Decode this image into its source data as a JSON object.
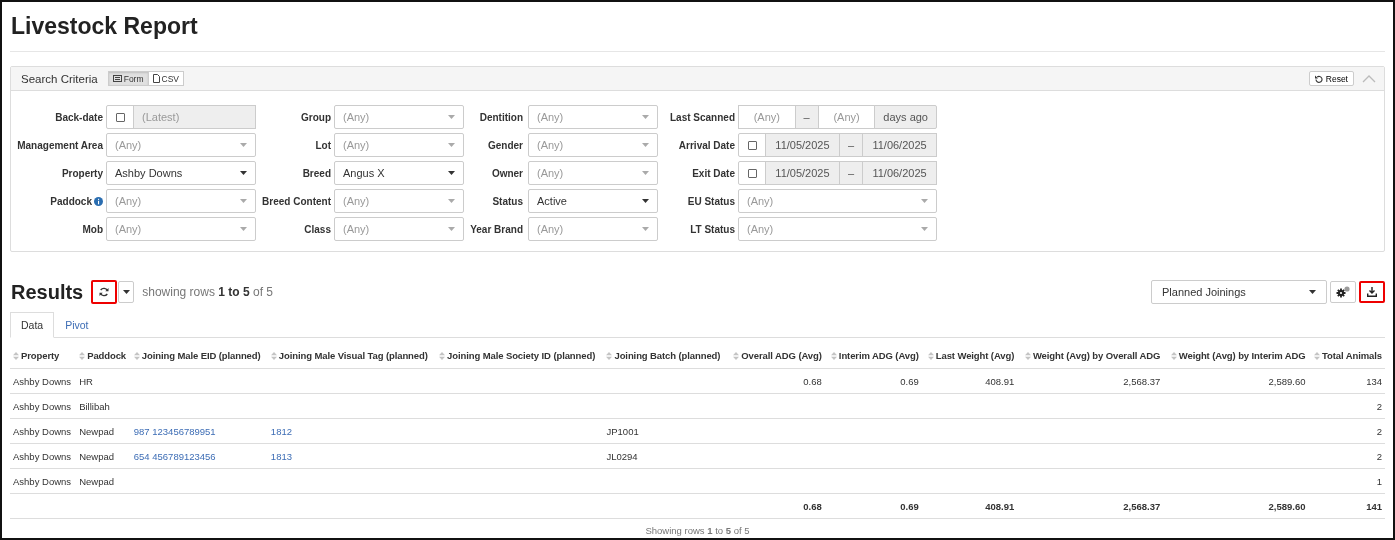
{
  "page_title": "Livestock Report",
  "search": {
    "title": "Search Criteria",
    "modes": [
      {
        "label": "Form",
        "kind": "form",
        "selected": true
      },
      {
        "label": "CSV",
        "kind": "csv",
        "selected": false
      }
    ],
    "reset": "Reset",
    "columns": [
      [
        {
          "label": "Back-date",
          "kind": "checkdate",
          "checked": false,
          "placeholder": "(Latest)"
        },
        {
          "label": "Management Area",
          "kind": "select",
          "placeholder": "(Any)"
        },
        {
          "label": "Property",
          "kind": "select",
          "value": "Ashby Downs"
        },
        {
          "label": "Paddock",
          "kind": "select",
          "placeholder": "(Any)",
          "info": true
        },
        {
          "label": "Mob",
          "kind": "select",
          "placeholder": "(Any)"
        }
      ],
      [
        {
          "label": "Group",
          "kind": "select",
          "placeholder": "(Any)"
        },
        {
          "label": "Lot",
          "kind": "select",
          "placeholder": "(Any)"
        },
        {
          "label": "Breed",
          "kind": "select",
          "value": "Angus X"
        },
        {
          "label": "Breed Content",
          "kind": "select",
          "placeholder": "(Any)"
        },
        {
          "label": "Class",
          "kind": "select",
          "placeholder": "(Any)"
        }
      ],
      [
        {
          "label": "Dentition",
          "kind": "select",
          "placeholder": "(Any)"
        },
        {
          "label": "Gender",
          "kind": "select",
          "placeholder": "(Any)"
        },
        {
          "label": "Owner",
          "kind": "select",
          "placeholder": "(Any)"
        },
        {
          "label": "Status",
          "kind": "select",
          "value": "Active"
        },
        {
          "label": "Year Brand",
          "kind": "select",
          "placeholder": "(Any)"
        }
      ],
      [
        {
          "label": "Last Scanned",
          "kind": "range",
          "from_placeholder": "(Any)",
          "separator": "–",
          "to_placeholder": "(Any)",
          "suffix": "days ago"
        },
        {
          "label": "Arrival Date",
          "kind": "daterange",
          "checked": false,
          "from": "11/05/2025",
          "separator": "–",
          "to": "11/06/2025"
        },
        {
          "label": "Exit Date",
          "kind": "daterange",
          "checked": false,
          "from": "11/05/2025",
          "separator": "–",
          "to": "11/06/2025"
        },
        {
          "label": "EU Status",
          "kind": "select",
          "placeholder": "(Any)"
        },
        {
          "label": "LT Status",
          "kind": "select",
          "placeholder": "(Any)"
        }
      ]
    ]
  },
  "results": {
    "title": "Results",
    "refresh_highlighted": true,
    "summary": "showing rows **1 to 5** of 5",
    "view": "Planned Joinings",
    "download_highlighted": true,
    "tabs": [
      {
        "label": "Data",
        "selected": true
      },
      {
        "label": "Pivot",
        "selected": false
      }
    ],
    "table": {
      "columns": [
        {
          "label": "Property",
          "kind": "text"
        },
        {
          "label": "Paddock",
          "kind": "text"
        },
        {
          "label": "Joining Male EID (planned)",
          "kind": "link"
        },
        {
          "label": "Joining Male Visual Tag (planned)",
          "kind": "link"
        },
        {
          "label": "Joining Male Society ID (planned)",
          "kind": "text"
        },
        {
          "label": "Joining Batch (planned)",
          "kind": "text"
        },
        {
          "label": "Overall ADG (Avg)",
          "kind": "number"
        },
        {
          "label": "Interim ADG (Avg)",
          "kind": "number"
        },
        {
          "label": "Last Weight (Avg)",
          "kind": "number"
        },
        {
          "label": "Weight (Avg) by Overall ADG",
          "kind": "number"
        },
        {
          "label": "Weight (Avg) by Interim ADG",
          "kind": "number"
        },
        {
          "label": "Total Animals",
          "kind": "number"
        }
      ],
      "rows": [
        [
          "Ashby Downs",
          "HR",
          null,
          null,
          null,
          null,
          "0.68",
          "0.69",
          "408.91",
          "2,568.37",
          "2,589.60",
          "134"
        ],
        [
          "Ashby Downs",
          "Billibah",
          null,
          null,
          null,
          null,
          null,
          null,
          null,
          null,
          null,
          "2"
        ],
        [
          "Ashby Downs",
          "Newpad",
          "987 123456789951",
          "1812",
          null,
          "JP1001",
          null,
          null,
          null,
          null,
          null,
          "2"
        ],
        [
          "Ashby Downs",
          "Newpad",
          "654 456789123456",
          "1813",
          null,
          "JL0294",
          null,
          null,
          null,
          null,
          null,
          "2"
        ],
        [
          "Ashby Downs",
          "Newpad",
          null,
          null,
          null,
          null,
          null,
          null,
          null,
          null,
          null,
          "1"
        ]
      ],
      "totals": [
        "0.68",
        "0.69",
        "408.91",
        "2,568.37",
        "2,589.60",
        "141"
      ]
    },
    "footer": "Showing rows **1** to **5** of 5"
  }
}
